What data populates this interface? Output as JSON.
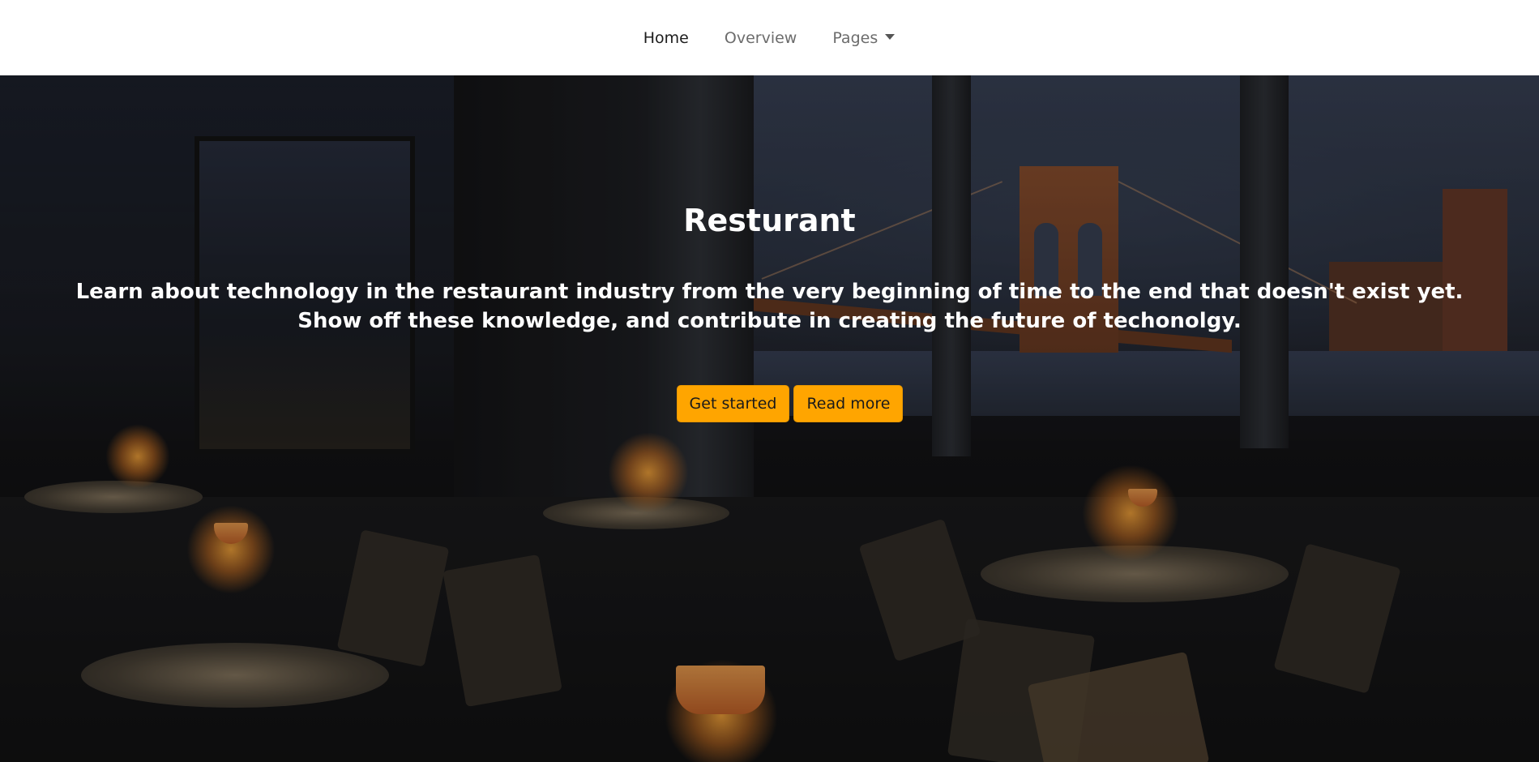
{
  "nav": {
    "items": [
      {
        "label": "Home",
        "active": true
      },
      {
        "label": "Overview",
        "active": false
      },
      {
        "label": "Pages",
        "active": false,
        "dropdown": true
      }
    ]
  },
  "hero": {
    "title": "Resturant",
    "text_line1": "Learn about technology in the restaurant industry from the very beginning of time to the end that doesn't exist yet.",
    "text_line2": "Show off these knowledge, and contribute in creating the future of techonolgy.",
    "buttons": {
      "primary_label": "Get started",
      "secondary_label": "Read more"
    },
    "background_image": "restaurant-interior-with-bridge-view"
  },
  "colors": {
    "accent": "#ffa500",
    "nav_background": "#ffffff",
    "hero_text": "#ffffff"
  }
}
